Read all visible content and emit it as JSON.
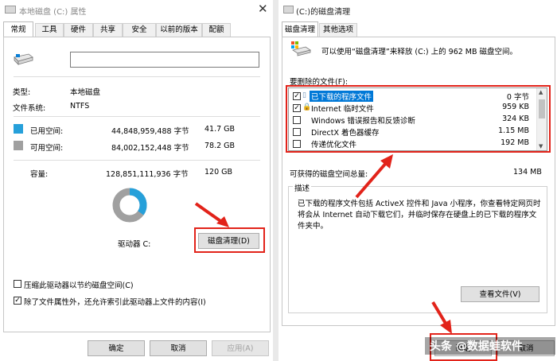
{
  "left": {
    "title": "本地磁盘 (C:) 属性",
    "tabs": [
      "常规",
      "工具",
      "硬件",
      "共享",
      "安全",
      "以前的版本",
      "配额"
    ],
    "type_label": "类型:",
    "type_value": "本地磁盘",
    "fs_label": "文件系统:",
    "fs_value": "NTFS",
    "used_label": "已用空间:",
    "used_bytes": "44,848,959,488 字节",
    "used_gb": "41.7 GB",
    "free_label": "可用空间:",
    "free_bytes": "84,002,152,448 字节",
    "free_gb": "78.2 GB",
    "cap_label": "容量:",
    "cap_bytes": "128,851,111,936 字节",
    "cap_gb": "120 GB",
    "drive_label": "驱动器 C:",
    "cleanup_button": "磁盘清理(D)",
    "compress_label": "压缩此驱动器以节约磁盘空间(C)",
    "index_label": "除了文件属性外，还允许索引此驱动器上文件的内容(I)",
    "ok": "确定",
    "cancel": "取消",
    "apply": "应用(A)",
    "colors": {
      "used": "#26a0da",
      "free": "#a0a0a0"
    },
    "usage": {
      "used_fraction": 0.348
    }
  },
  "right": {
    "title": "(C:)的磁盘清理",
    "tabs": [
      "磁盘清理",
      "其他选项"
    ],
    "intro": "可以使用“磁盘清理”来释放 (C:) 上的 962 MB 磁盘空间。",
    "files_label": "要删除的文件(F):",
    "files": [
      {
        "name": "已下载的程序文件",
        "size": "0 字节",
        "checked": true,
        "icon": "folder-icon"
      },
      {
        "name": "Internet 临时文件",
        "size": "959 KB",
        "checked": true,
        "icon": "lock-icon"
      },
      {
        "name": "Windows 错误报告和反馈诊断",
        "size": "324 KB",
        "checked": false,
        "icon": ""
      },
      {
        "name": "DirectX 着色器缓存",
        "size": "1.15 MB",
        "checked": false,
        "icon": ""
      },
      {
        "name": "传递优化文件",
        "size": "192 MB",
        "checked": false,
        "icon": ""
      }
    ],
    "total_label": "可获得的磁盘空间总量:",
    "total_value": "134 MB",
    "desc_label": "描述",
    "desc_text": "已下载的程序文件包括 ActiveX 控件和 Java 小程序，你查看特定网页时将会从 Internet 自动下载它们，并临时保存在硬盘上的已下载的程序文件夹中。",
    "view_files": "查看文件(V)",
    "ok": "确定",
    "cancel": "取消"
  },
  "watermark": "头条 @数据蛙软件"
}
